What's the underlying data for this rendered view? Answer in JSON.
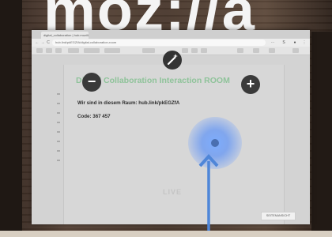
{
  "background": {
    "big_text": "moz://a"
  },
  "browser": {
    "tab_title": "digital_collaboration | hub.mozilla",
    "url": "hub.link/pkEGZfA/digital-collaboration-room",
    "nav": {
      "back": "←",
      "forward": "→",
      "reload": "C"
    },
    "extensions": [
      "⋯",
      "S",
      "●",
      "⋮"
    ]
  },
  "document": {
    "title": "Digital Collaboration Interaction ROOM",
    "line_room": "Wir sind in diesem Raum: hub.link/pkEGZfA",
    "line_code": "Code: 367 457",
    "watermark": "LIVE",
    "corner_button": "SEITENANSICHT"
  },
  "controls": {
    "zoom_out": "−",
    "zoom_in": "+"
  },
  "colors": {
    "title_green": "#8fc39a",
    "cursor_blue": "#6a9cf5",
    "arrow_blue": "#4f86d8"
  }
}
